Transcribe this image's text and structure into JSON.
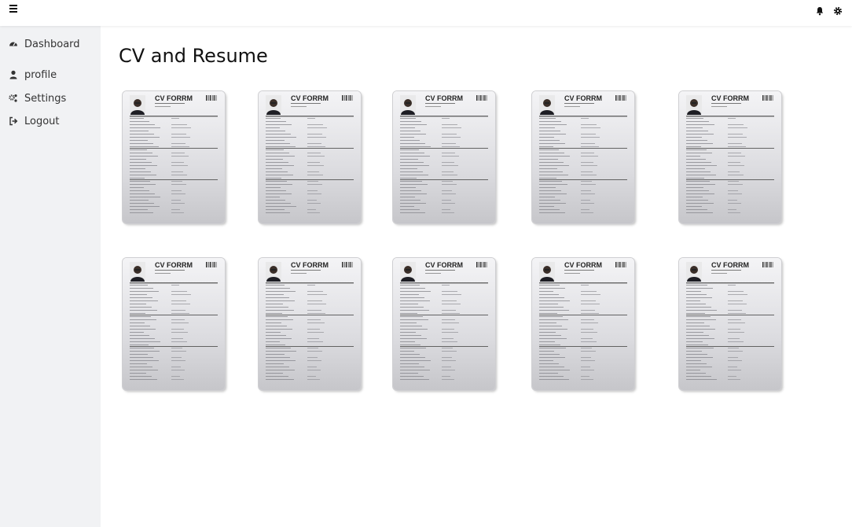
{
  "header": {
    "menu_icon": "hamburger-icon",
    "notification_icon": "bell-icon",
    "settings_icon": "gear-icon"
  },
  "sidebar": {
    "items": [
      {
        "label": "Dashboard",
        "icon": "tachometer-icon"
      },
      {
        "label": "profile",
        "icon": "user-icon"
      },
      {
        "label": "Settings",
        "icon": "gears-icon"
      },
      {
        "label": "Logout",
        "icon": "sign-out-icon"
      }
    ]
  },
  "main": {
    "title": "CV and Resume",
    "template_heading": "CV FORRM",
    "templates_count": 10
  }
}
